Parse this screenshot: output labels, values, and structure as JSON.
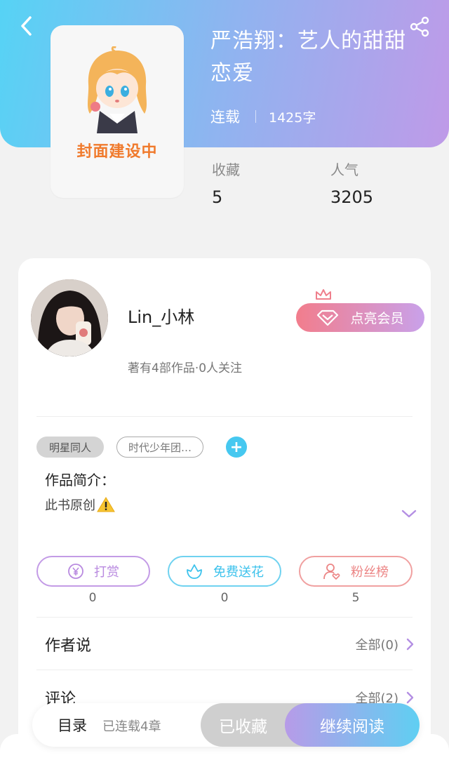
{
  "book": {
    "title": "严浩翔：艺人的甜甜恋爱",
    "status": "连载",
    "word_count": "1425字",
    "cover_text": "封面建设中",
    "stats": [
      {
        "label": "收藏",
        "value": "5"
      },
      {
        "label": "人气",
        "value": "3205"
      }
    ]
  },
  "author": {
    "name": "Lin_小林",
    "info": "著有4部作品·0人关注",
    "vip_button": "点亮会员"
  },
  "tags": [
    "明星同人",
    "时代少年团…"
  ],
  "intro": {
    "title": "作品简介：",
    "body": "此书原创"
  },
  "actions": [
    {
      "label": "打赏",
      "count": "0",
      "color": "#b98ae0"
    },
    {
      "label": "免费送花",
      "count": "0",
      "color": "#4cc9ee"
    },
    {
      "label": "粉丝榜",
      "count": "5",
      "color": "#ef8a8a"
    }
  ],
  "sections": [
    {
      "title": "作者说",
      "right": "全部(0)"
    },
    {
      "title": "评论",
      "right": "全部(2)"
    }
  ],
  "bottom_bar": {
    "toc": "目录",
    "chapters": "已连载4章",
    "collected": "已收藏",
    "continue": "继续阅读"
  },
  "icons": {
    "back": "chevron-left-icon",
    "share": "share-icon",
    "vip": "diamond-icon",
    "crown": "crown-icon",
    "warning": "warning-icon",
    "expand": "chevron-down-icon",
    "tip": "yen-coin-icon",
    "flower": "flower-icon",
    "fans": "user-heart-icon"
  }
}
